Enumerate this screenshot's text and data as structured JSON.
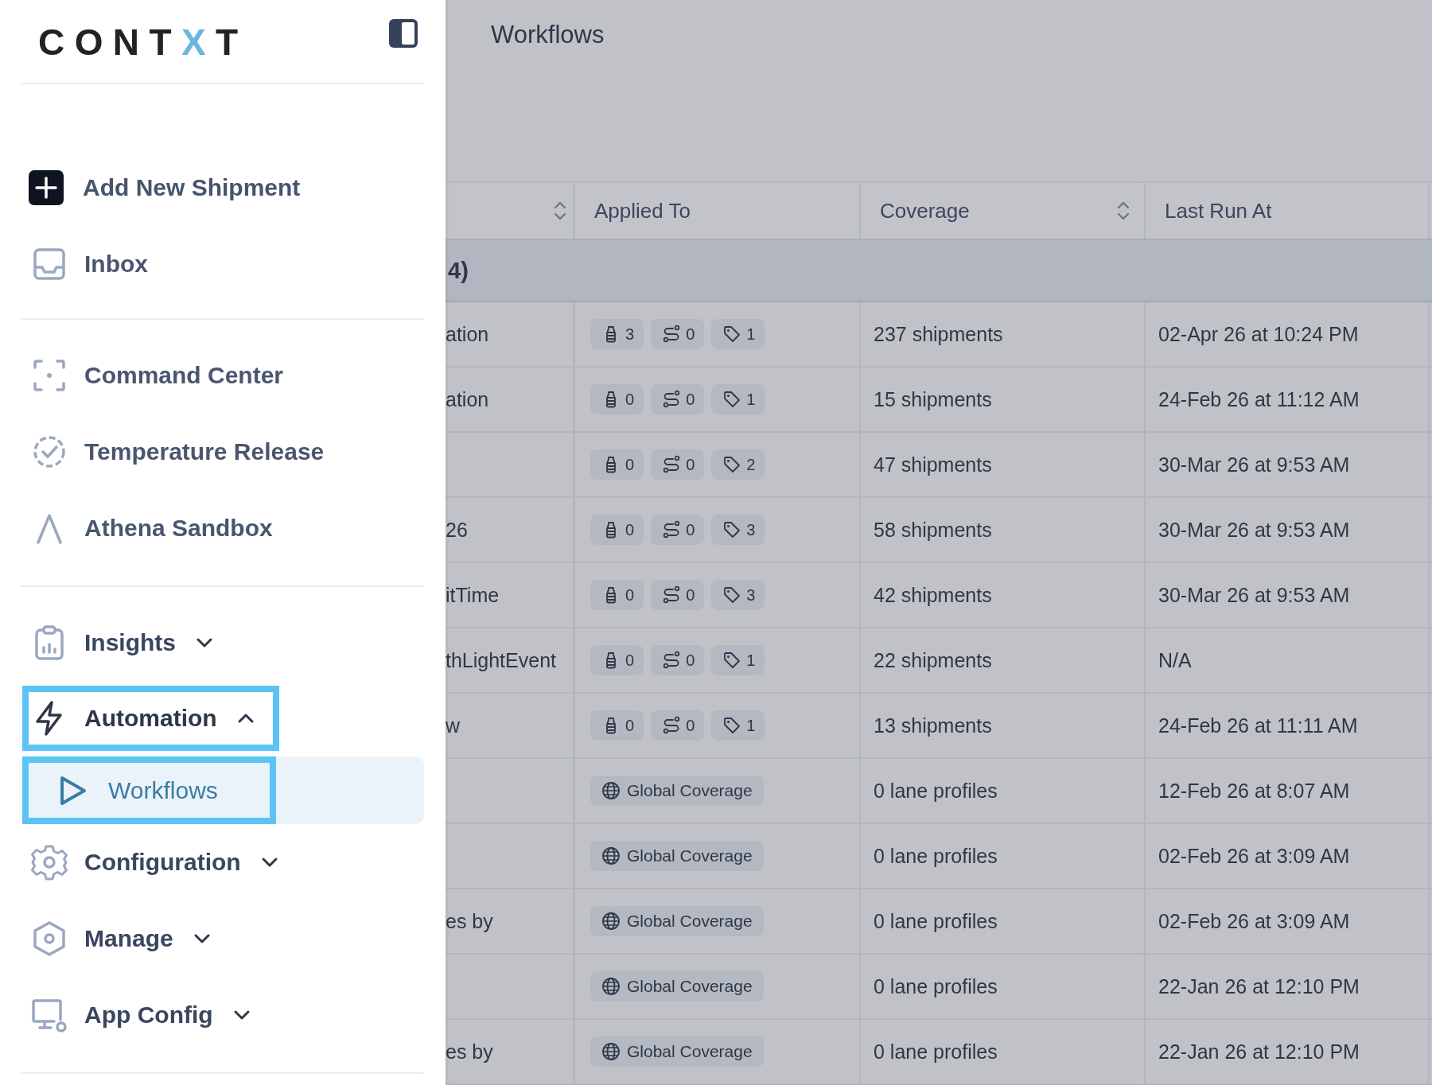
{
  "logo": {
    "main": "CONT",
    "accent": "X",
    "tail": "T"
  },
  "breadcrumb": {
    "current": "Workflows"
  },
  "sidebar": {
    "sections": [
      [
        {
          "label": "Add New Shipment",
          "kind": "action"
        },
        {
          "label": "Inbox",
          "kind": "link"
        }
      ],
      [
        {
          "label": "Command Center",
          "kind": "link"
        },
        {
          "label": "Temperature Release",
          "kind": "link"
        },
        {
          "label": "Athena Sandbox",
          "kind": "link"
        }
      ],
      [
        {
          "label": "Insights",
          "kind": "group",
          "expanded": false,
          "highlighted": false
        },
        {
          "label": "Automation",
          "kind": "group",
          "expanded": true,
          "highlighted": true,
          "children": [
            {
              "label": "Workflows",
              "selected": true,
              "highlighted": true
            }
          ]
        },
        {
          "label": "Configuration",
          "kind": "group",
          "expanded": false,
          "highlighted": false
        },
        {
          "label": "Manage",
          "kind": "group",
          "expanded": false,
          "highlighted": false
        },
        {
          "label": "App Config",
          "kind": "group",
          "expanded": false,
          "highlighted": false
        }
      ]
    ]
  },
  "table": {
    "columns": [
      {
        "sortable": true
      },
      {
        "label": "Applied To",
        "sortable": false
      },
      {
        "label": "Coverage",
        "sortable": true
      },
      {
        "label": "Last Run At",
        "sortable": false
      }
    ],
    "group": {
      "label": "4)"
    },
    "rows": [
      {
        "name": "ation",
        "applied": {
          "kind": "counts",
          "counts": [
            "3",
            "0",
            "1"
          ]
        },
        "coverage": "237 shipments",
        "last_run": "02-Apr 26 at 10:24 PM"
      },
      {
        "name": "ation",
        "applied": {
          "kind": "counts",
          "counts": [
            "0",
            "0",
            "1"
          ]
        },
        "coverage": "15 shipments",
        "last_run": "24-Feb 26 at 11:12 AM"
      },
      {
        "applied": {
          "kind": "counts",
          "counts": [
            "0",
            "0",
            "2"
          ]
        },
        "coverage": "47 shipments",
        "last_run": "30-Mar 26 at 9:53 AM"
      },
      {
        "name": "26",
        "applied": {
          "kind": "counts",
          "counts": [
            "0",
            "0",
            "3"
          ]
        },
        "coverage": "58 shipments",
        "last_run": "30-Mar 26 at 9:53 AM"
      },
      {
        "name": "itTime",
        "applied": {
          "kind": "counts",
          "counts": [
            "0",
            "0",
            "3"
          ]
        },
        "coverage": "42 shipments",
        "last_run": "30-Mar 26 at 9:53 AM"
      },
      {
        "name": "thLightEvent",
        "applied": {
          "kind": "counts",
          "counts": [
            "0",
            "0",
            "1"
          ]
        },
        "coverage": "22 shipments",
        "last_run": "N/A"
      },
      {
        "name": "w",
        "applied": {
          "kind": "counts",
          "counts": [
            "0",
            "0",
            "1"
          ]
        },
        "coverage": "13 shipments",
        "last_run": "24-Feb 26 at 11:11 AM"
      },
      {
        "applied": {
          "kind": "global",
          "label": "Global Coverage"
        },
        "coverage": "0 lane profiles",
        "last_run": "12-Feb 26 at 8:07 AM"
      },
      {
        "applied": {
          "kind": "global",
          "label": "Global Coverage"
        },
        "coverage": "0 lane profiles",
        "last_run": "02-Feb 26 at 3:09 AM"
      },
      {
        "name": "es by",
        "applied": {
          "kind": "global",
          "label": "Global Coverage"
        },
        "coverage": "0 lane profiles",
        "last_run": "02-Feb 26 at 3:09 AM"
      },
      {
        "applied": {
          "kind": "global",
          "label": "Global Coverage"
        },
        "coverage": "0 lane profiles",
        "last_run": "22-Jan 26 at 12:10 PM"
      },
      {
        "name": "es by",
        "applied": {
          "kind": "global",
          "label": "Global Coverage"
        },
        "coverage": "0 lane profiles",
        "last_run": "22-Jan 26 at 12:10 PM"
      }
    ]
  }
}
